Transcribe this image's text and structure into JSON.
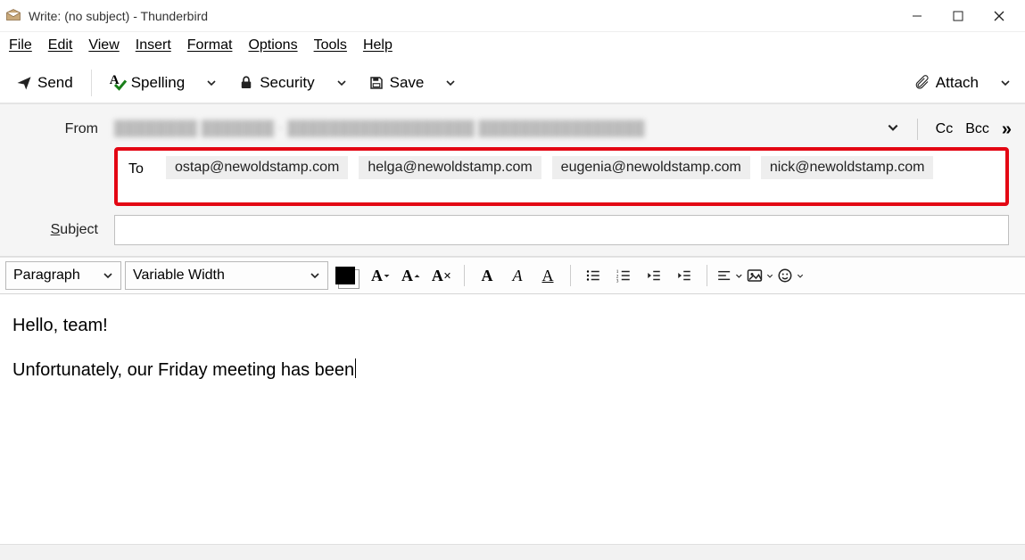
{
  "window": {
    "title": "Write: (no subject) - Thunderbird"
  },
  "menu": {
    "file": "File",
    "edit": "Edit",
    "view": "View",
    "insert": "Insert",
    "format": "Format",
    "options": "Options",
    "tools": "Tools",
    "help": "Help"
  },
  "toolbar": {
    "send": "Send",
    "spelling": "Spelling",
    "security": "Security",
    "save": "Save",
    "attach": "Attach"
  },
  "headers": {
    "from_label": "From",
    "from_blurred_placeholder": "████████ ███████ · ██████████████████   ████████████████",
    "cc": "Cc",
    "bcc": "Bcc",
    "to_label": "To",
    "to_recipients": [
      "ostap@newoldstamp.com",
      "helga@newoldstamp.com",
      "eugenia@newoldstamp.com",
      "nick@newoldstamp.com"
    ],
    "subject_label": "Subject",
    "subject_value": ""
  },
  "format": {
    "paragraph_style": "Paragraph",
    "font_family": "Variable Width"
  },
  "body": {
    "line1": "Hello, team!",
    "line2": "Unfortunately, our Friday meeting has been"
  }
}
